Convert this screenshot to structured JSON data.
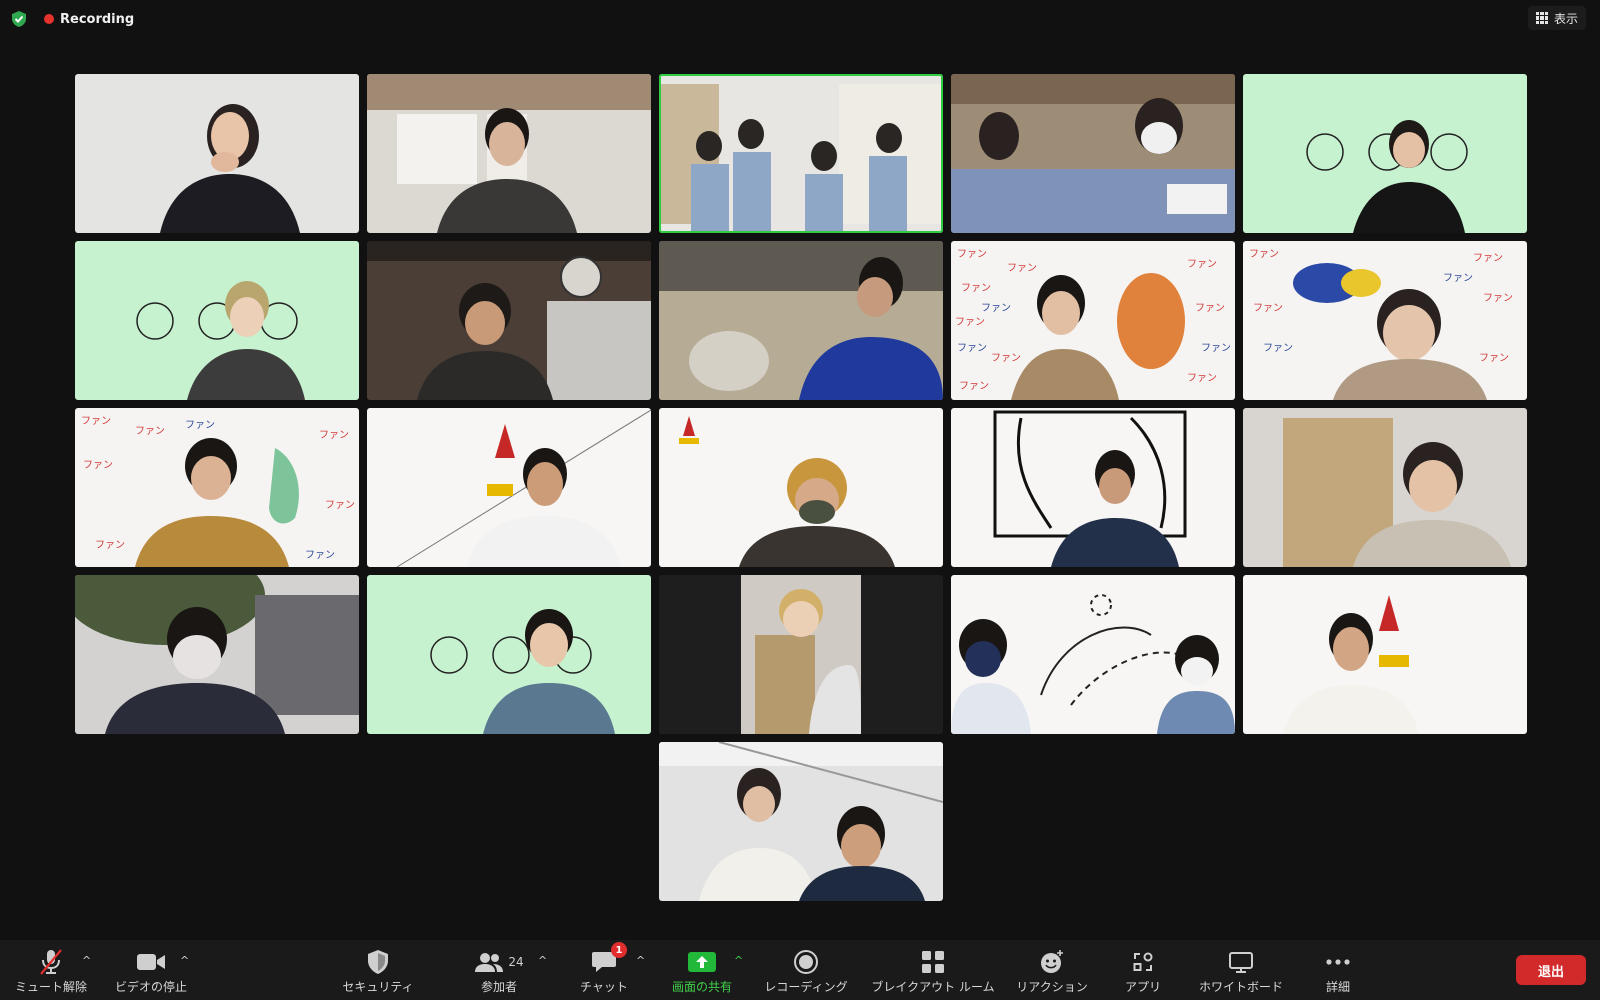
{
  "topbar": {
    "recording_label": "Recording",
    "view_label": "表示"
  },
  "toolbar": {
    "mute_label": "ミュート解除",
    "video_label": "ビデオの停止",
    "security_label": "セキュリティ",
    "participants_label": "参加者",
    "participants_count": "24",
    "chat_label": "チャット",
    "chat_badge": "1",
    "share_label": "画面の共有",
    "record_label": "レコーディング",
    "breakout_label": "ブレイクアウト ルーム",
    "reactions_label": "リアクション",
    "apps_label": "アプリ",
    "whiteboard_label": "ホワイトボード",
    "more_label": "詳細",
    "leave_label": "退出"
  },
  "colors": {
    "background": "#111111",
    "toolbar_bg": "#1a1a1a",
    "active_speaker_border": "#2ecc40",
    "share_green": "#40d04a",
    "leave_red": "#d22a2a",
    "recording_red": "#e5322d"
  }
}
